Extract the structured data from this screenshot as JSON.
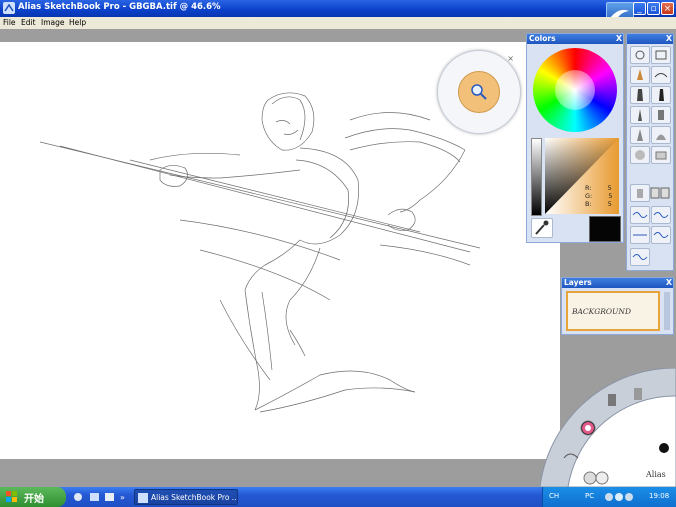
{
  "window": {
    "title": "Alias SketchBook Pro - GBGBA.tif @ 46.6%"
  },
  "menu": {
    "items": [
      "File",
      "Edit",
      "Image",
      "Help"
    ]
  },
  "colors_panel": {
    "title": "Colors",
    "close": "X",
    "rgb": {
      "r_label": "R:",
      "r": "5",
      "g_label": "G:",
      "g": "5",
      "b_label": "B:",
      "b": "5"
    },
    "current_color": "#050505"
  },
  "layers_panel": {
    "title": "Layers",
    "close": "X",
    "layer_name": "BACKGROUND"
  },
  "navigator": {
    "close": "×"
  },
  "lagoon": {
    "brand": "Alias"
  },
  "taskbar": {
    "start_label": "开始",
    "window_item": "Alias SketchBook Pro ...",
    "tray_lang": "CH",
    "tray_ime": "PC",
    "clock": "19:08"
  },
  "colors": {
    "accent": "#0a40c8",
    "panel_bg": "#d8e2f2",
    "lagoon": "#c9cfd8"
  }
}
